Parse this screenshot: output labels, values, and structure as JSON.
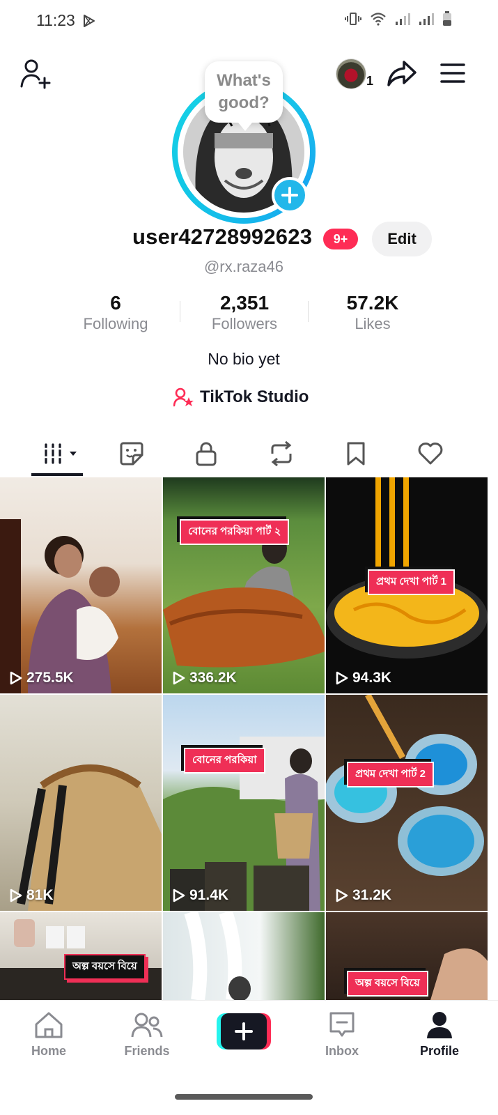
{
  "status_bar": {
    "time": "11:23"
  },
  "header": {
    "notifications_count": "1"
  },
  "avatar": {
    "bubble_text": "What's good?"
  },
  "profile": {
    "username": "user42728992623",
    "badge": "9+",
    "edit_label": "Edit",
    "handle": "@rx.raza46",
    "bio": "No bio yet",
    "studio_label": "TikTok Studio"
  },
  "stats": {
    "following": {
      "value": "6",
      "label": "Following"
    },
    "followers": {
      "value": "2,351",
      "label": "Followers"
    },
    "likes": {
      "value": "57.2K",
      "label": "Likes"
    }
  },
  "tabs": [
    {
      "name": "videos",
      "icon": "grid-icon"
    },
    {
      "name": "stickers",
      "icon": "sticker-icon"
    },
    {
      "name": "private",
      "icon": "lock-icon"
    },
    {
      "name": "reposts",
      "icon": "repost-icon"
    },
    {
      "name": "favorites",
      "icon": "bookmark-icon"
    },
    {
      "name": "liked",
      "icon": "heart-icon"
    }
  ],
  "videos": [
    {
      "views": "275.5K",
      "caption": ""
    },
    {
      "views": "336.2K",
      "caption": "বোনের পরকিয়া পার্ট ২"
    },
    {
      "views": "94.3K",
      "caption": "প্রথম দেখা পার্ট 1"
    },
    {
      "views": "81K",
      "caption": ""
    },
    {
      "views": "91.4K",
      "caption": "বোনের পরকিয়া"
    },
    {
      "views": "31.2K",
      "caption": "প্রথম দেখা পার্ট 2"
    },
    {
      "views": "",
      "caption": "অল্প বয়সে বিয়ে"
    },
    {
      "views": "",
      "caption": ""
    },
    {
      "views": "",
      "caption": "অল্প বয়সে বিয়ে"
    }
  ],
  "nav": {
    "home": "Home",
    "friends": "Friends",
    "inbox": "Inbox",
    "profile": "Profile"
  },
  "colors": {
    "accent": "#fe2c55",
    "cyan": "#25f4ee",
    "ring": "#19d3e6"
  }
}
